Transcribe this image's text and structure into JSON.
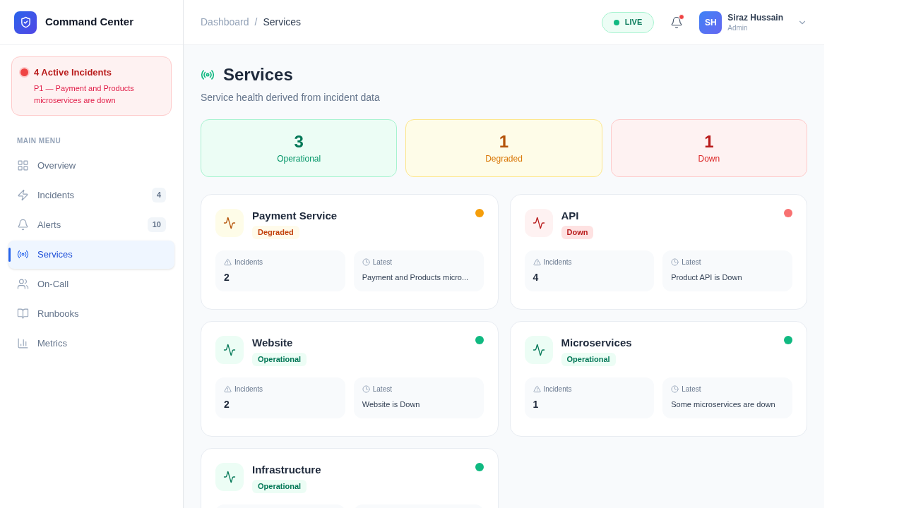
{
  "brand": {
    "name": "Command Center"
  },
  "incident_banner": {
    "title": "4 Active Incidents",
    "message": "P1 — Payment and Products microservices are down"
  },
  "sidebar": {
    "section_label": "MAIN MENU",
    "items": [
      {
        "kind": "grid",
        "label": "Overview",
        "selected": false
      },
      {
        "kind": "bolt",
        "label": "Incidents",
        "badge": "4",
        "selected": false
      },
      {
        "kind": "bell",
        "label": "Alerts",
        "badge": "10",
        "selected": false
      },
      {
        "kind": "radio",
        "label": "Services",
        "selected": true
      },
      {
        "kind": "users",
        "label": "On-Call",
        "selected": false
      },
      {
        "kind": "book",
        "label": "Runbooks",
        "selected": false
      },
      {
        "kind": "chart",
        "label": "Metrics",
        "selected": false
      }
    ]
  },
  "breadcrumb": [
    "Dashboard",
    "Services"
  ],
  "breadcrumb_separator": "/",
  "header": {
    "live": "LIVE",
    "notification_unread": true,
    "user": {
      "initials": "SH",
      "name": "Siraz Hussain",
      "role": "Admin"
    }
  },
  "page": {
    "title": "Services",
    "subtitle": "Service health derived from incident data"
  },
  "summary": [
    {
      "kind": "operational",
      "count": "3",
      "label": "Operational"
    },
    {
      "kind": "degraded",
      "count": "1",
      "label": "Degraded"
    },
    {
      "kind": "down",
      "count": "1",
      "label": "Down"
    }
  ],
  "services": [
    {
      "name": "Payment Service",
      "kind": "degraded",
      "status_label": "Degraded",
      "color": "#f59e0b",
      "incidents_label": "Incidents",
      "incidents": "2",
      "latest_label": "Latest",
      "latest": "Payment and Products micro..."
    },
    {
      "name": "API",
      "kind": "down",
      "status_label": "Down",
      "color": "#f87171",
      "incidents_label": "Incidents",
      "incidents": "4",
      "latest_label": "Latest",
      "latest": "Product API is Down"
    },
    {
      "name": "Website",
      "kind": "operational",
      "status_label": "Operational",
      "color": "#10b981",
      "incidents_label": "Incidents",
      "incidents": "2",
      "latest_label": "Latest",
      "latest": "Website is Down"
    },
    {
      "name": "Microservices",
      "kind": "operational",
      "status_label": "Operational",
      "color": "#10b981",
      "incidents_label": "Incidents",
      "incidents": "1",
      "latest_label": "Latest",
      "latest": "Some microservices are down"
    },
    {
      "name": "Infrastructure",
      "kind": "operational",
      "status_label": "Operational",
      "color": "#10b981"
    }
  ]
}
